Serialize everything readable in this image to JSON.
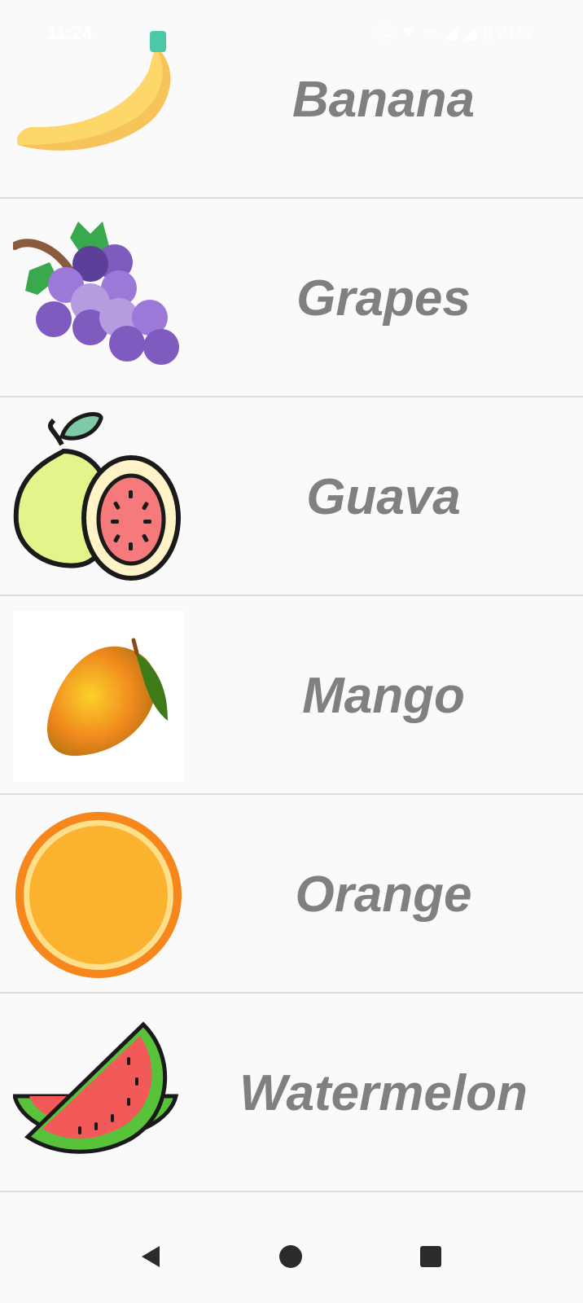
{
  "status_bar": {
    "time": "11:24",
    "battery": "21%",
    "icons": [
      "mute-icon",
      "wifi-icon",
      "sim-icon",
      "signal-icon",
      "signal-icon",
      "battery-icon"
    ]
  },
  "fruits": [
    {
      "label": "Banana",
      "icon": "banana-icon"
    },
    {
      "label": "Grapes",
      "icon": "grapes-icon"
    },
    {
      "label": "Guava",
      "icon": "guava-icon"
    },
    {
      "label": "Mango",
      "icon": "mango-icon"
    },
    {
      "label": "Orange",
      "icon": "orange-icon"
    },
    {
      "label": "Watermelon",
      "icon": "watermelon-icon"
    }
  ],
  "colors": {
    "background": "#fafafa",
    "label": "#808080",
    "divider": "#dcdcdc",
    "nav": "#2b2b2b"
  },
  "nav_bar": {
    "buttons": [
      "back-icon",
      "home-icon",
      "recents-icon"
    ]
  }
}
